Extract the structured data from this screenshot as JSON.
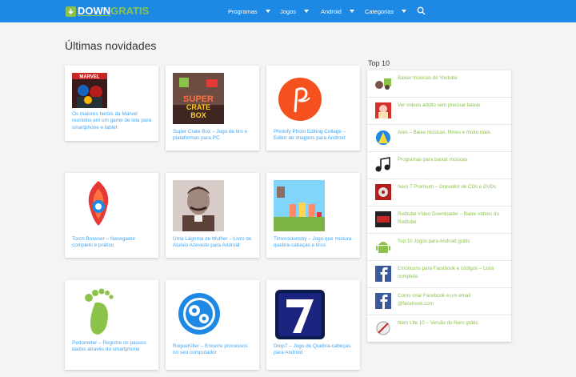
{
  "header": {
    "logo_part1": "DOWN",
    "logo_part2": "GRATIS",
    "nav": [
      "Programas",
      "Jogos",
      "Android",
      "Categorias"
    ]
  },
  "main": {
    "title": "Últimas novidades",
    "posts": [
      {
        "caption": "Os maiores heróis da Marvel reunidos em um game de luta para smartphone e tablet",
        "icon": "marvel-heroes-icon"
      },
      {
        "caption": "Super Crate Box – Jogo de tiro e plataformas para PC",
        "icon": "super-crate-box-icon"
      },
      {
        "caption": "Photofy Photo Editing Collage – Editor de imagens para Android",
        "icon": "photofy-icon"
      },
      {
        "caption": "Torch Browser – Navegador completo e prático",
        "icon": "torch-browser-icon"
      },
      {
        "caption": "Uma Lágrima de Mulher – Livro de Aluísio Azevedo para Android",
        "icon": "author-portrait-icon"
      },
      {
        "caption": "Timerocketsby – Jogo que mistura quebra-cabeças e tiros",
        "icon": "timerocketsby-icon"
      },
      {
        "caption": "Pedometer – Registre os passos dados através do smartphone",
        "icon": "footprint-icon"
      },
      {
        "caption": "RogueKiller – Encerre processos no seu computador",
        "icon": "gears-icon"
      },
      {
        "caption": "Drop7 – Jogo de Quebra-cabeças para Android",
        "icon": "drop7-icon"
      }
    ]
  },
  "sidebar": {
    "title": "Top 10",
    "items": [
      {
        "label": "Baixar músicas do Youtube",
        "icon": "music-download-icon"
      },
      {
        "label": "Ver vídeos adulto sem precisar baixar",
        "icon": "adult-video-icon"
      },
      {
        "label": "Ares – Baixe músicas, filmes e muito mais",
        "icon": "ares-icon"
      },
      {
        "label": "Programas para baixar músicas",
        "icon": "music-notes-icon"
      },
      {
        "label": "Nero 7 Premium – Gravador de CDs e DVDs",
        "icon": "nero7-icon"
      },
      {
        "label": "Redtube Vídeo Downloader – Baixe vídeos do Redtube",
        "icon": "redtube-icon"
      },
      {
        "label": "Top 10 Jogos para Android grátis",
        "icon": "android-icon"
      },
      {
        "label": "Emoticons para Facebook e códigos – Lista completa",
        "icon": "facebook-icon"
      },
      {
        "label": "Como criar Facebook e um email @facebook.com",
        "icon": "facebook-icon"
      },
      {
        "label": "Nero Lite 10 – Versão do Nero grátis",
        "icon": "nero-lite-icon"
      }
    ]
  },
  "colors": {
    "header": "#1e88e5",
    "accent_green": "#8bc34a",
    "link_blue": "#42a5f5"
  }
}
